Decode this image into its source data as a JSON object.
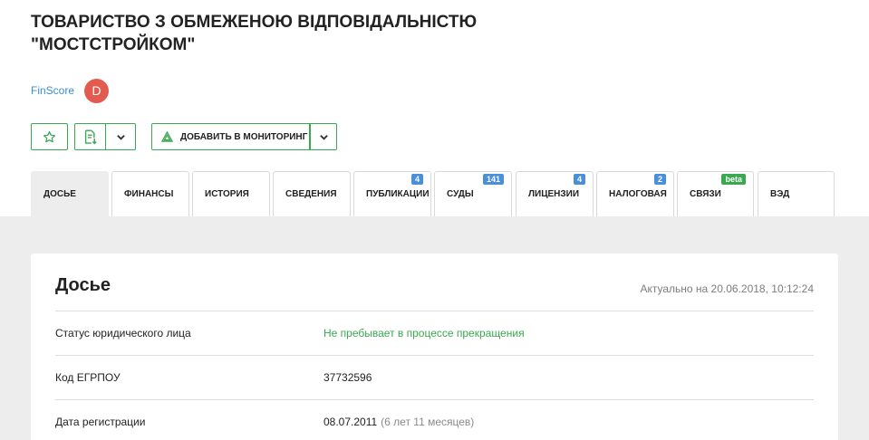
{
  "company": {
    "title": "ТОВАРИСТВО З ОБМЕЖЕНОЮ ВІДПОВІДАЛЬНІСТЮ \"МОСТСТРОЙКОМ\""
  },
  "finscore": {
    "label": "FinScore",
    "grade": "D",
    "grade_color": "#e35b4f"
  },
  "toolbar": {
    "favorite_icon": "star-icon",
    "export_icon": "export-document-icon",
    "dropdown_icon": "chevron-down-icon",
    "monitor_icon": "monitoring-triangle-icon",
    "monitor_label": "ДОБАВИТЬ В МОНИТОРИНГ"
  },
  "tabs": [
    {
      "label": "ДОСЬЕ",
      "active": true,
      "badge": ""
    },
    {
      "label": "ФИНАНСЫ",
      "badge": ""
    },
    {
      "label": "ИСТОРИЯ",
      "badge": ""
    },
    {
      "label": "СВЕДЕНИЯ",
      "badge": ""
    },
    {
      "label": "ПУБЛИКАЦИИ",
      "badge": "4"
    },
    {
      "label": "СУДЫ",
      "badge": "141"
    },
    {
      "label": "ЛИЦЕНЗИИ",
      "badge": "4"
    },
    {
      "label": "НАЛОГОВАЯ",
      "badge": "2"
    },
    {
      "label": "СВЯЗИ",
      "badge": "beta"
    },
    {
      "label": "ВЭД",
      "badge": ""
    }
  ],
  "dossier": {
    "title": "Досье",
    "updated": "Актуально на 20.06.2018, 10:12:24",
    "rows": [
      {
        "label": "Статус юридического лица",
        "value": "Не пребывает в процессе прекращения",
        "note": ""
      },
      {
        "label": "Код ЕГРПОУ",
        "value": "37732596",
        "note": ""
      },
      {
        "label": "Дата регистрации",
        "value": "08.07.2011",
        "note": "(6 лет 11 месяцев)"
      }
    ]
  },
  "colors": {
    "accent_green": "#3aa851",
    "badge_blue": "#4a90d9",
    "link_blue": "#3a8ed6",
    "background_grey": "#ededed"
  }
}
